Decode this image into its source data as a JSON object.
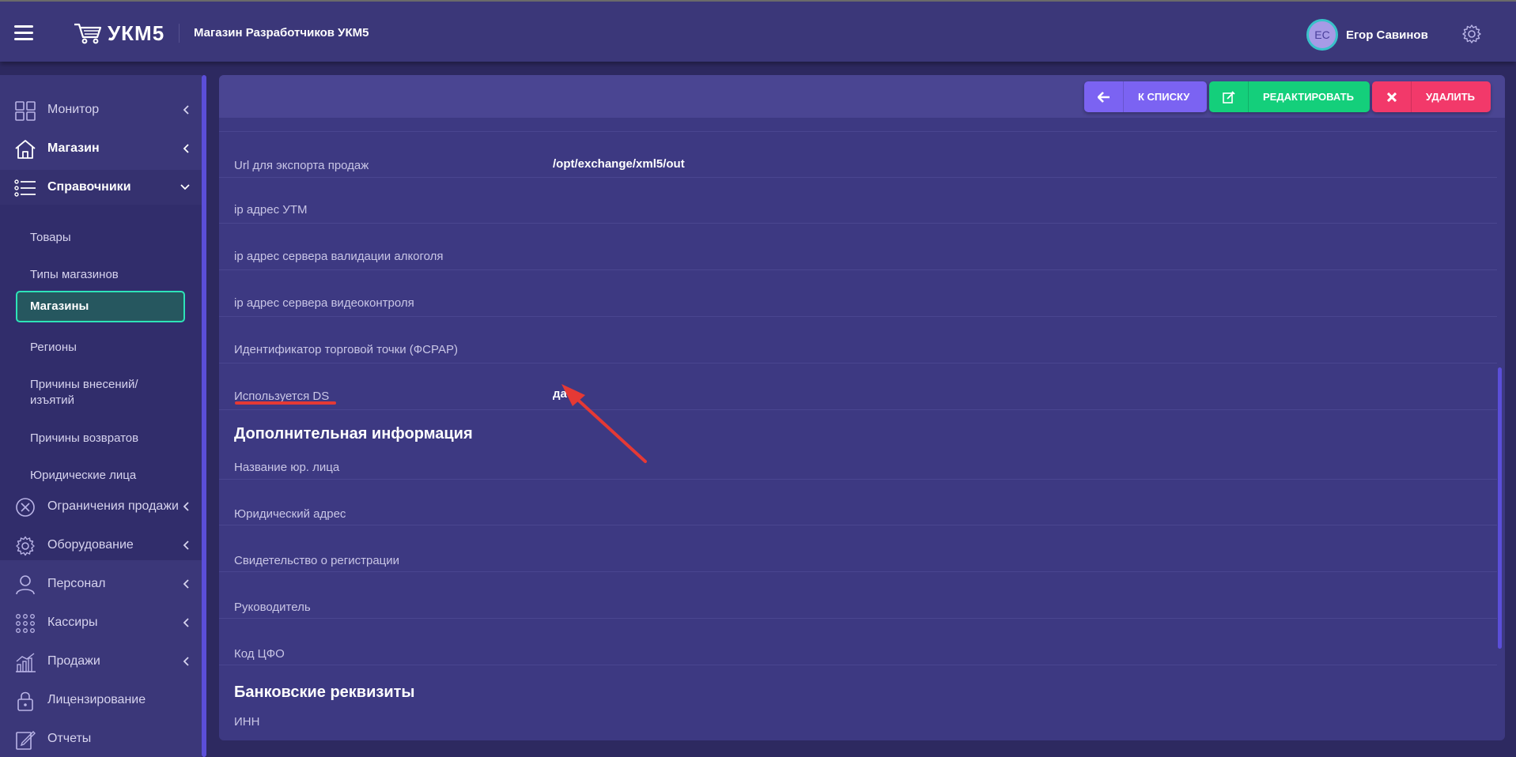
{
  "header": {
    "logo_text": "УКМ5",
    "store_title": "Магазин Разработчиков УКМ5",
    "user_initials": "ЕС",
    "user_name": "Егор Савинов"
  },
  "sidebar": {
    "items": [
      {
        "label": "Монитор",
        "icon": "monitor-grid-icon"
      },
      {
        "label": "Магазин",
        "icon": "home-icon"
      },
      {
        "label": "Справочники",
        "icon": "list-icon"
      },
      {
        "label": "Ограничения продажи",
        "icon": "circle-x-icon"
      },
      {
        "label": "Оборудование",
        "icon": "gear-icon"
      },
      {
        "label": "Персонал",
        "icon": "person-icon"
      },
      {
        "label": "Кассиры",
        "icon": "dots-grid-icon"
      },
      {
        "label": "Продажи",
        "icon": "chart-icon"
      },
      {
        "label": "Лицензирование",
        "icon": "lock-icon"
      },
      {
        "label": "Отчеты",
        "icon": "edit-icon"
      }
    ],
    "submenu": [
      "Товары",
      "Типы магазинов",
      "Магазины",
      "Регионы",
      "Причины внесений/",
      "изъятий",
      "Причины возвратов",
      "Юридические лица"
    ]
  },
  "toolbar": {
    "back_label": "К СПИСКУ",
    "edit_label": "РЕДАКТИРОВАТЬ",
    "delete_label": "УДАЛИТЬ"
  },
  "details": {
    "rows": [
      {
        "label": "Url для экспорта продаж",
        "value": "/opt/exchange/xml5/out"
      },
      {
        "label": "ip адрес УТМ",
        "value": ""
      },
      {
        "label": "ip адрес сервера валидации алкоголя",
        "value": ""
      },
      {
        "label": "ip адрес сервера видеоконтроля",
        "value": ""
      },
      {
        "label": "Идентификатор торговой точки (ФСРАР)",
        "value": ""
      },
      {
        "label": "Используется DS",
        "value": "да"
      }
    ],
    "section_additional": "Дополнительная информация",
    "additional_rows": [
      {
        "label": "Название юр. лица"
      },
      {
        "label": "Юридический адрес"
      },
      {
        "label": "Свидетельство о регистрации"
      },
      {
        "label": "Руководитель"
      },
      {
        "label": "Код ЦФО"
      }
    ],
    "section_bank": "Банковские реквизиты",
    "bank_rows": [
      {
        "label": "ИНН"
      }
    ]
  },
  "colors": {
    "accent_active": "#2ee3b8",
    "btn_list": "#7b63f2",
    "btn_edit": "#14cf7b",
    "btn_delete": "#f2396a",
    "annotation": "#e53935"
  }
}
